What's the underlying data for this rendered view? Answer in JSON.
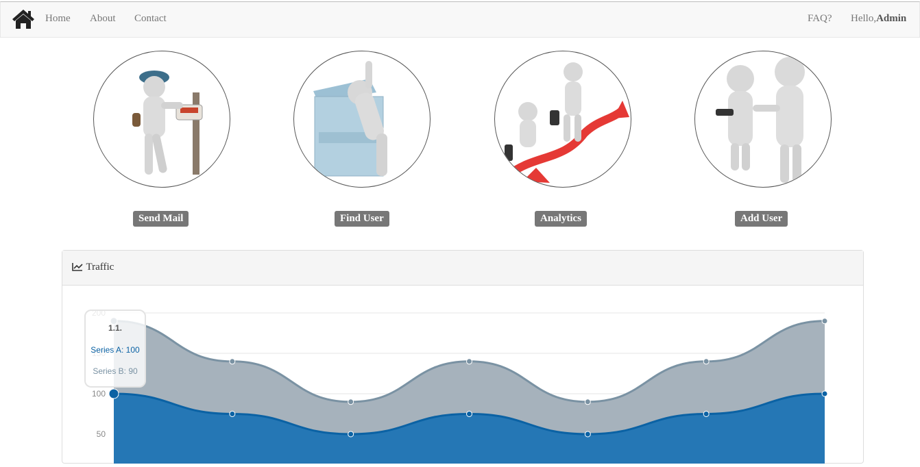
{
  "navbar": {
    "brand_icon": "home-icon",
    "links": [
      "Home",
      "About",
      "Contact"
    ],
    "faq": "FAQ?",
    "greeting": "Hello,",
    "user": "Admin"
  },
  "tiles": [
    {
      "label": "Send Mail",
      "image": "mail-carrier-figure"
    },
    {
      "label": "Find User",
      "image": "dumpster-search-figure"
    },
    {
      "label": "Analytics",
      "image": "growth-arrow-figures"
    },
    {
      "label": "Add User",
      "image": "handshake-figures"
    }
  ],
  "panel": {
    "icon": "line-chart-icon",
    "title": "Traffic"
  },
  "tooltip": {
    "title": "1.1.",
    "series_a": "Series A: 100",
    "series_b": "Series B: 90"
  },
  "chart_data": {
    "type": "area",
    "stacked": true,
    "x_count": 7,
    "series": [
      {
        "name": "Series A",
        "values": [
          100,
          75,
          50,
          75,
          50,
          75,
          100
        ],
        "color": "#0b62a4"
      },
      {
        "name": "Series B",
        "values": [
          90,
          65,
          40,
          65,
          40,
          65,
          90
        ],
        "color": "#7a92a3"
      }
    ],
    "y_ticks": [
      50,
      100,
      150,
      200
    ],
    "ylim": [
      0,
      200
    ],
    "grid": true
  }
}
